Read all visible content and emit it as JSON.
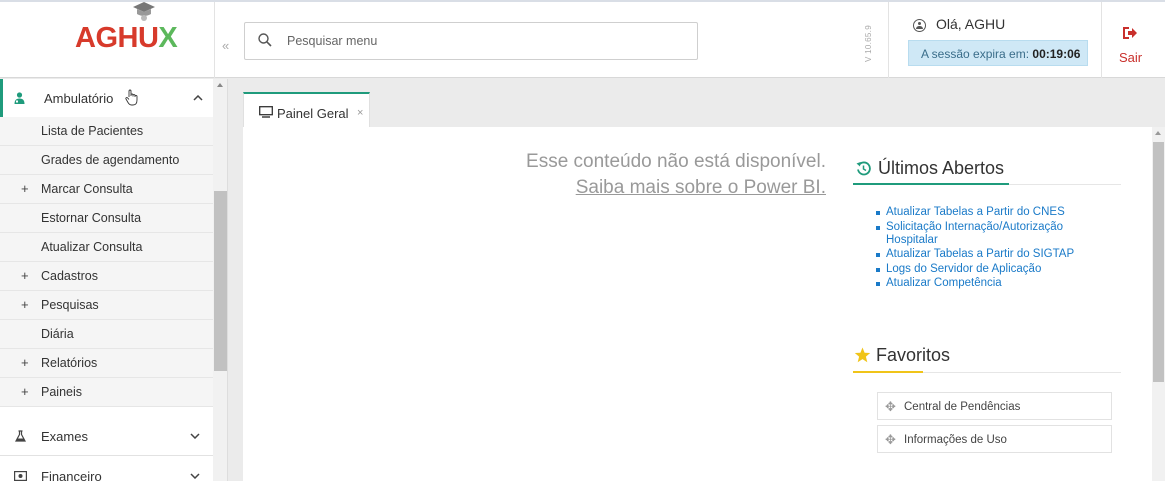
{
  "header": {
    "logo": {
      "part1": "AGH",
      "part2": "U",
      "part3": "X"
    },
    "collapse_glyph": "«",
    "search_placeholder": "Pesquisar menu",
    "version": "V 10.65.9",
    "greeting": "Olá, AGHU",
    "session_label": "A sessão expira em:",
    "session_time": "00:19:06",
    "exit_label": "Sair"
  },
  "sidebar": {
    "sections": [
      {
        "label": "Ambulatório",
        "icon": "doctor-icon",
        "expanded": true
      },
      {
        "label": "Exames",
        "icon": "flask-icon",
        "expanded": false
      },
      {
        "label": "Financeiro",
        "icon": "money-icon",
        "expanded": false
      }
    ],
    "items": [
      {
        "label": "Lista de Pacientes",
        "plus": ""
      },
      {
        "label": "Grades de agendamento",
        "plus": ""
      },
      {
        "label": "Marcar Consulta",
        "plus": "+"
      },
      {
        "label": "Estornar Consulta",
        "plus": ""
      },
      {
        "label": "Atualizar Consulta",
        "plus": ""
      },
      {
        "label": "Cadastros",
        "plus": "+"
      },
      {
        "label": "Pesquisas",
        "plus": "+"
      },
      {
        "label": "Diária",
        "plus": ""
      },
      {
        "label": "Relatórios",
        "plus": "+"
      },
      {
        "label": "Paineis",
        "plus": "+"
      }
    ]
  },
  "tab": {
    "label": "Painel Geral",
    "close": "×"
  },
  "powerbi": {
    "message": "Esse conteúdo não está disponível.",
    "link": "Saiba mais sobre o Power BI."
  },
  "recent": {
    "title": "Últimos Abertos",
    "items": [
      "Atualizar Tabelas a Partir do CNES",
      "Solicitação Internação/Autorização Hospitalar",
      "Atualizar Tabelas a Partir do SIGTAP",
      "Logs do Servidor de Aplicação",
      "Atualizar Competência"
    ]
  },
  "favorites": {
    "title": "Favoritos",
    "items": [
      "Central de Pendências",
      "Informações de Uso"
    ]
  },
  "colors": {
    "accent": "#1f9b7c",
    "logo_red": "#d73a2b",
    "logo_green": "#5cb85c",
    "link": "#1a7ac8",
    "star": "#f0c419",
    "exit": "#c9302c",
    "session_bg": "#cfe8f6"
  }
}
